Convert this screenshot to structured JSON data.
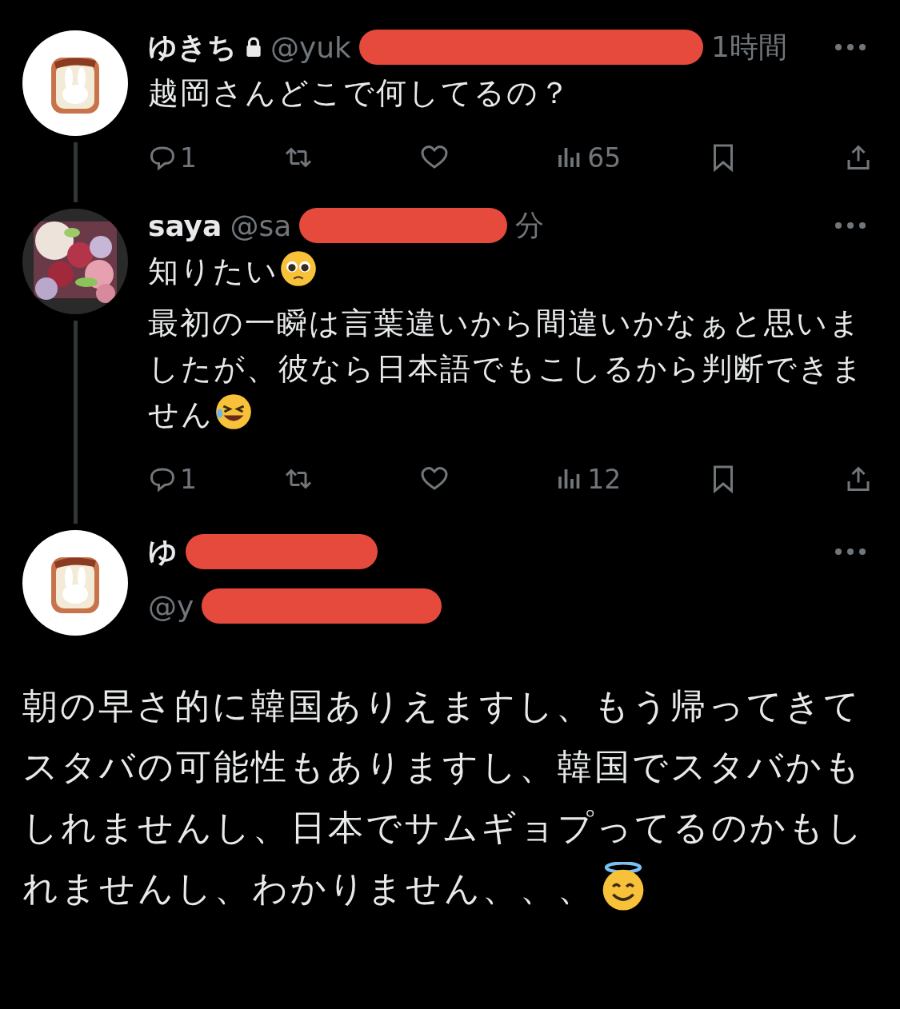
{
  "thread": [
    {
      "avatar": {
        "kind": "toast"
      },
      "name": "ゆきち",
      "locked": true,
      "handle": "@yuk",
      "time": "1時間",
      "body": [
        {
          "text": "越岡さんどこで何してるの？"
        }
      ],
      "stats": {
        "replies": "1",
        "views": "65"
      }
    },
    {
      "avatar": {
        "kind": "flowers"
      },
      "name": "saya",
      "locked": false,
      "handle": "@sa",
      "time": "分",
      "body": [
        {
          "text": "知りたい",
          "kind": "pleading"
        },
        {
          "text": "最初の一瞬は言葉違いから間違いかなぁと思いましたが、彼なら日本語でもこしるから判断できません",
          "kind": "rofl"
        }
      ],
      "stats": {
        "replies": "1",
        "views": "12"
      }
    }
  ],
  "main": {
    "avatar": {
      "kind": "toast"
    },
    "name": "ゆ",
    "handle": "@y",
    "body": [
      {
        "text": "朝の早さ的に韓国ありえますし、もう帰ってきてスタバの可能性もありますし、韓国でスタバかもしれませんし、日本でサムギョプってるのかもしれませんし、わかりません、、、",
        "kind": "halo"
      }
    ]
  }
}
